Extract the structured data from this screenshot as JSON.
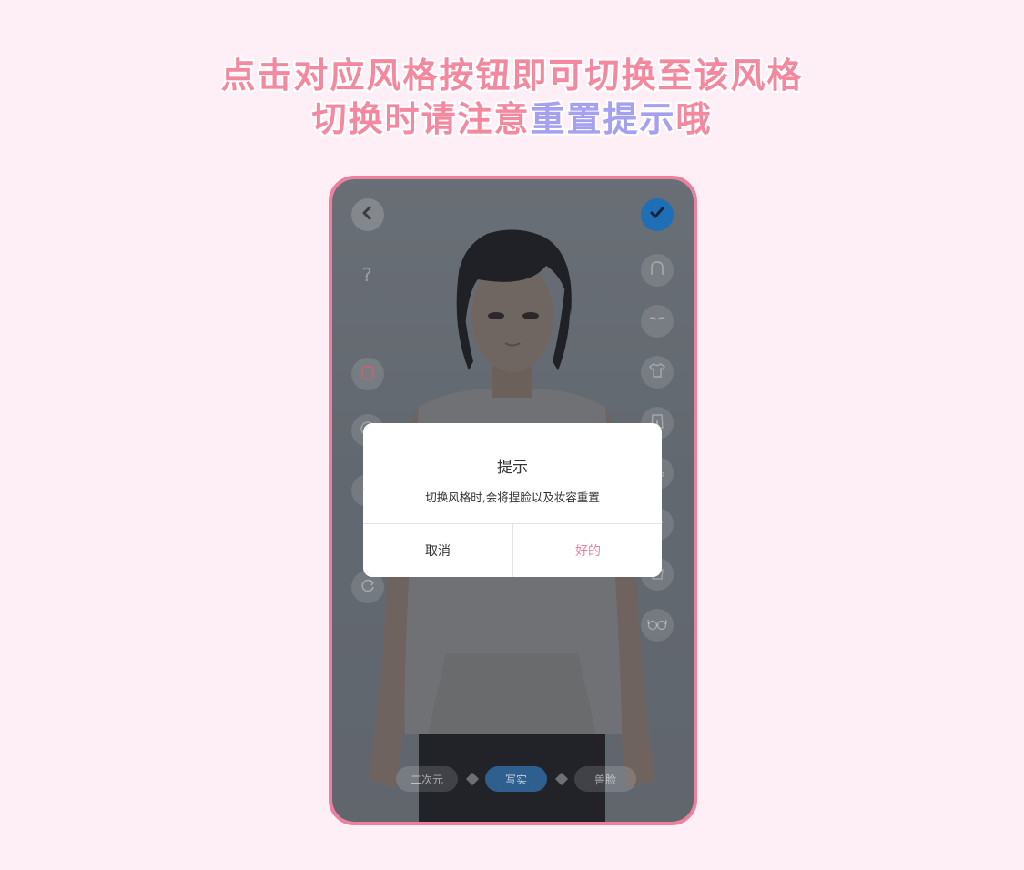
{
  "header": {
    "line1": "点击对应风格按钮即可切换至该风格",
    "line2_prefix": "切换时请注意",
    "line2_highlight": "重置提示",
    "line2_suffix": "哦"
  },
  "top_bar": {
    "back_icon": "chevron-left-icon",
    "confirm_icon": "checkmark-icon",
    "help_label": "?"
  },
  "left_tools": [
    "body-icon",
    "face-icon",
    "makeup-icon",
    "reset-icon"
  ],
  "right_tools": [
    "hair-icon",
    "eyebrow-icon",
    "shirt-icon",
    "pants-icon",
    "shoe-icon",
    "accessory-icon",
    "bag-icon",
    "glasses-icon"
  ],
  "style_switch": {
    "options": [
      "二次元",
      "写实",
      "兽脸"
    ],
    "selected": "写实"
  },
  "dialog": {
    "title": "提示",
    "message": "切换风格时,会将捏脸以及妆容重置",
    "cancel_label": "取消",
    "ok_label": "好的"
  },
  "colors": {
    "background": "#fdeff5",
    "accent_pink": "#f07f9d",
    "highlight_purple": "#a6a0f0",
    "confirm_blue": "#1e6fb6"
  }
}
